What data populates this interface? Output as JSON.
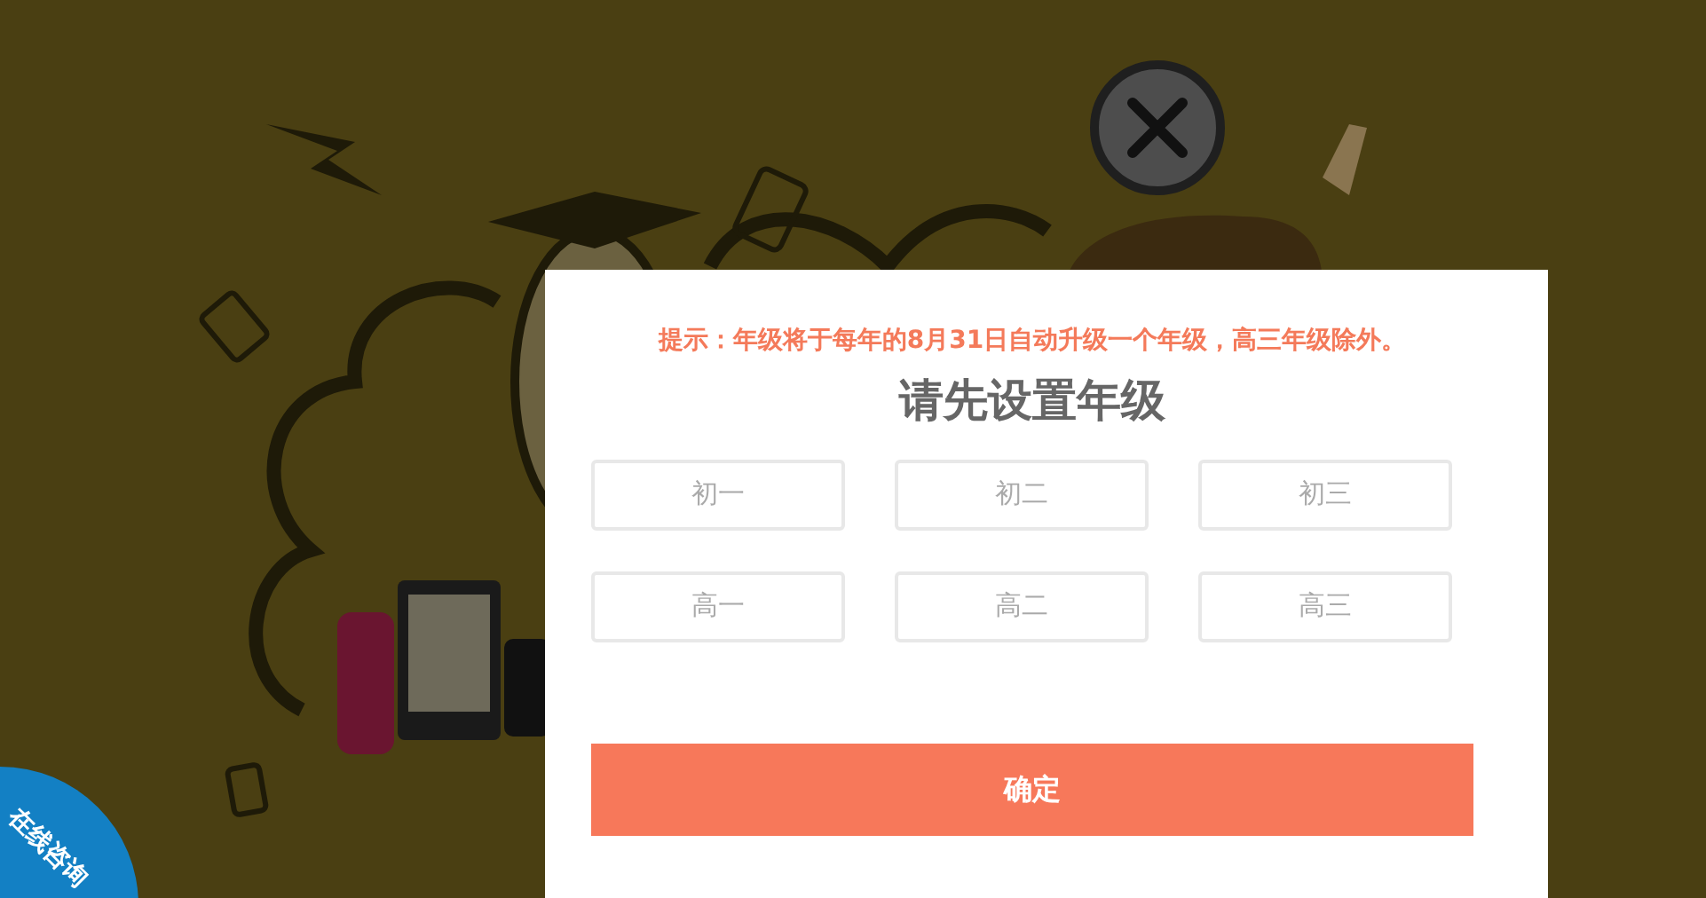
{
  "dialog": {
    "notice": "提示：年级将于每年的8月31日自动升级一个年级，高三年级除外。",
    "title": "请先设置年级",
    "grades": [
      {
        "label": "初一",
        "selected": false
      },
      {
        "label": "初二",
        "selected": false
      },
      {
        "label": "初三",
        "selected": false
      },
      {
        "label": "高一",
        "selected": false
      },
      {
        "label": "高二",
        "selected": false
      },
      {
        "label": "高三",
        "selected": false
      }
    ],
    "confirm": "确定"
  },
  "consult_badge": "在线咨询"
}
